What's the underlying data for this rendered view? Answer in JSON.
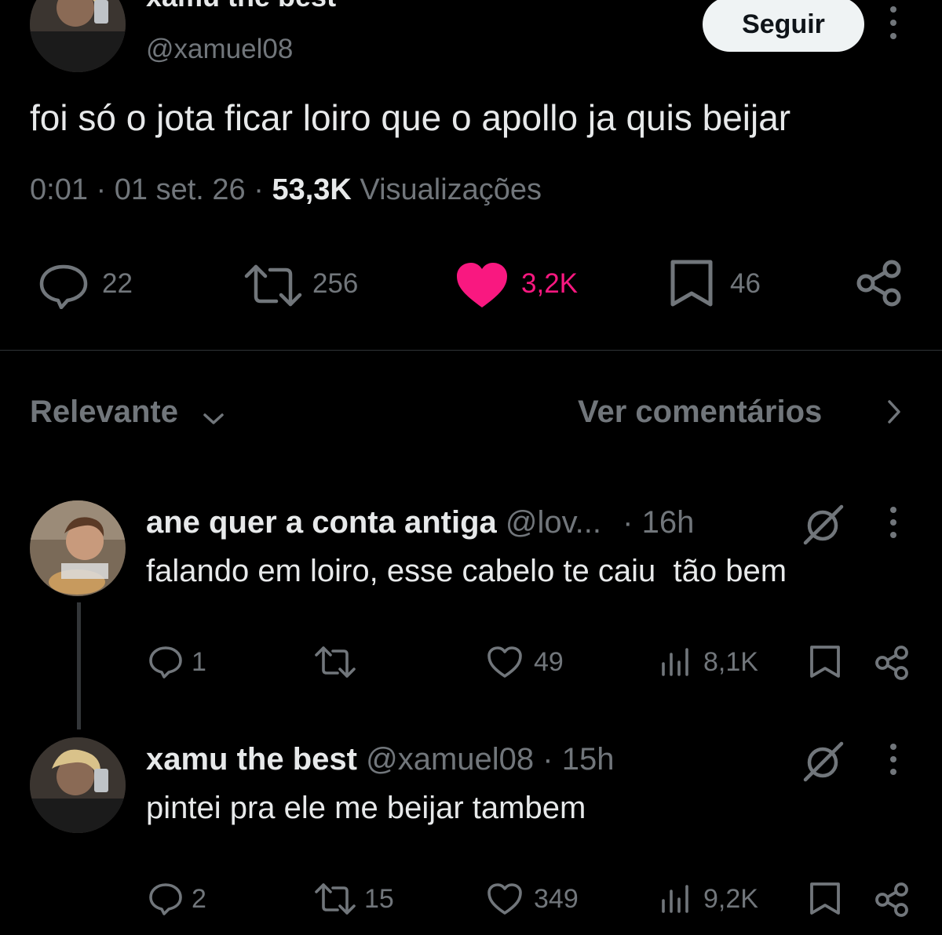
{
  "tweet": {
    "author_name": "xamu the best",
    "author_handle": "@xamuel08",
    "follow_label": "Seguir",
    "text": "foi só o jota ficar loiro que o apollo ja quis beijar",
    "time": "0:01",
    "date": "01 set. 26",
    "views_count": "53,3K",
    "views_label": "Visualizações",
    "stats": {
      "replies": "22",
      "retweets": "256",
      "likes": "3,2K",
      "bookmarks": "46"
    },
    "liked": true,
    "like_color": "#f91880"
  },
  "sort": {
    "label": "Relevante",
    "view_comments": "Ver comentários"
  },
  "replies": [
    {
      "name": "ane quer a conta antiga",
      "handle": "@lov...",
      "time": "· 16h",
      "text": "falando em loiro, esse cabelo te caiu  tão bem",
      "replies": "1",
      "retweets": "",
      "likes": "49",
      "views": "8,1K"
    },
    {
      "name": "xamu the best",
      "handle": "@xamuel08",
      "time": "· 15h",
      "text": "pintei pra ele me beijar tambem",
      "replies": "2",
      "retweets": "15",
      "likes": "349",
      "views": "9,2K"
    }
  ]
}
